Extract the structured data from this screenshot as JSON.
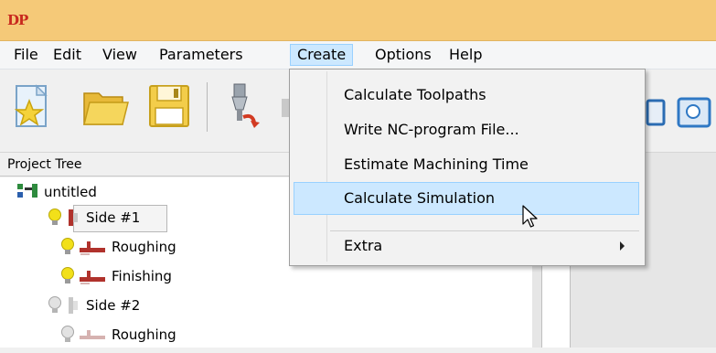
{
  "app": {
    "logo_text": "DP"
  },
  "menubar": {
    "items": [
      {
        "label": "File"
      },
      {
        "label": "Edit"
      },
      {
        "label": "View"
      },
      {
        "label": "Parameters"
      },
      {
        "label": "Create",
        "active": true
      },
      {
        "label": "Options"
      },
      {
        "label": "Help"
      }
    ]
  },
  "toolbar": {
    "buttons": [
      {
        "icon": "new-project-star-icon"
      },
      {
        "icon": "open-folder-icon"
      },
      {
        "icon": "save-floppy-icon"
      },
      {
        "icon": "machine-tool-icon"
      }
    ]
  },
  "project_tree": {
    "header": "Project Tree",
    "root": "untitled",
    "items": [
      {
        "label": "Side #1",
        "level": 1,
        "enabled": true
      },
      {
        "label": "Roughing",
        "level": 2,
        "enabled": true
      },
      {
        "label": "Finishing",
        "level": 2,
        "enabled": true
      },
      {
        "label": "Side #2",
        "level": 1,
        "enabled": false
      },
      {
        "label": "Roughing",
        "level": 2,
        "enabled": false
      }
    ]
  },
  "create_menu": {
    "items": [
      {
        "label": "Calculate Toolpaths"
      },
      {
        "label": "Write NC-program File..."
      },
      {
        "label": "Estimate Machining Time"
      },
      {
        "label": "Calculate Simulation",
        "hovered": true
      },
      {
        "label": "Extra",
        "submenu": true
      }
    ]
  },
  "colors": {
    "titlebar": "#f5c978",
    "menu_highlight": "#cce8ff",
    "menu_highlight_border": "#99d1ff",
    "bulb_on": "#f2e01a",
    "bulb_off": "#c8c8c8",
    "tool_red": "#b0322c"
  }
}
